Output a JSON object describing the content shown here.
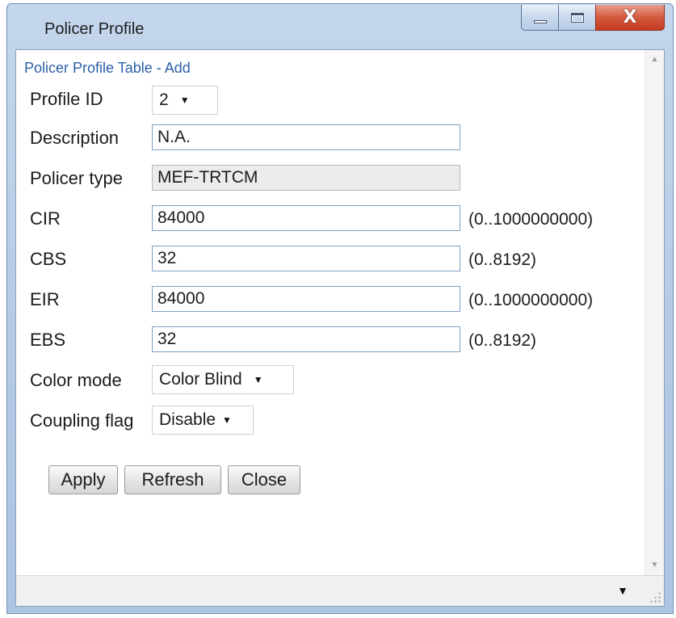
{
  "window": {
    "title": "Policer Profile",
    "controls": {
      "minimize": "minimize-icon",
      "maximize": "maximize-icon",
      "close": "close-icon"
    }
  },
  "form": {
    "heading": "Policer Profile Table - Add",
    "profile_id": {
      "label": "Profile ID",
      "value": "2"
    },
    "description": {
      "label": "Description",
      "value": "N.A."
    },
    "policer_type": {
      "label": "Policer type",
      "value": "MEF-TRTCM"
    },
    "cir": {
      "label": "CIR",
      "value": "84000",
      "range": "(0..1000000000)"
    },
    "cbs": {
      "label": "CBS",
      "value": "32",
      "range": "(0..8192)"
    },
    "eir": {
      "label": "EIR",
      "value": "84000",
      "range": "(0..1000000000)"
    },
    "ebs": {
      "label": "EBS",
      "value": "32",
      "range": "(0..8192)"
    },
    "color_mode": {
      "label": "Color mode",
      "value": "Color Blind"
    },
    "coupling_flag": {
      "label": "Coupling flag",
      "value": "Disable"
    }
  },
  "buttons": {
    "apply": "Apply",
    "refresh": "Refresh",
    "close": "Close"
  },
  "glyphs": {
    "caret": "▼",
    "scroll_up": "▲",
    "scroll_down": "▼",
    "close_x": "X"
  }
}
